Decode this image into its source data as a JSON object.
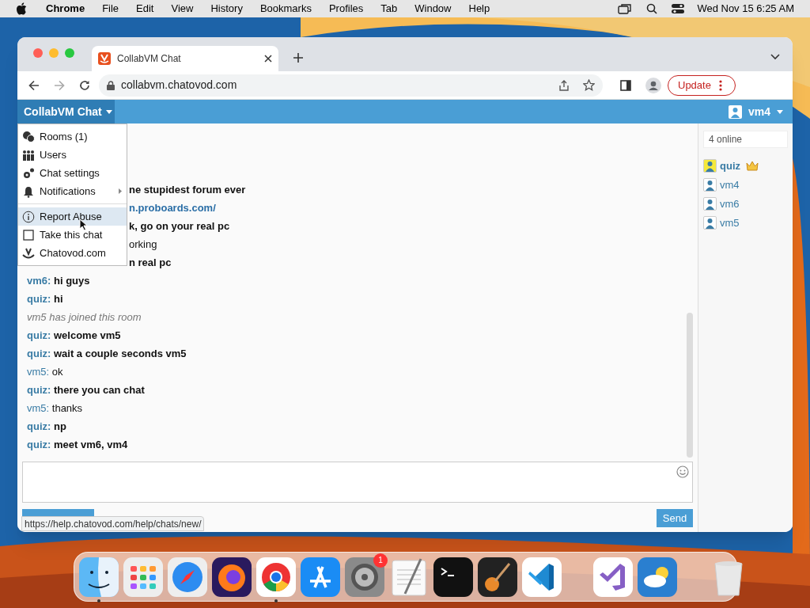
{
  "menubar": {
    "app": "Chrome",
    "menus": [
      "File",
      "Edit",
      "View",
      "History",
      "Bookmarks",
      "Profiles",
      "Tab",
      "Window",
      "Help"
    ],
    "clock": "Wed Nov 15 6:25 AM"
  },
  "browser": {
    "tab_title": "CollabVM Chat",
    "url": "collabvm.chatovod.com",
    "update_button": "Update"
  },
  "app": {
    "title": "CollabVM Chat",
    "account": "vm4",
    "menu": [
      {
        "kind": "rooms",
        "label": "Rooms (1)",
        "selected": false,
        "submenu": false
      },
      {
        "kind": "users",
        "label": "Users",
        "selected": false,
        "submenu": false
      },
      {
        "kind": "settings",
        "label": "Chat settings",
        "selected": false,
        "submenu": false
      },
      {
        "kind": "bell",
        "label": "Notifications",
        "selected": false,
        "submenu": true
      },
      {
        "kind": "separator"
      },
      {
        "kind": "info",
        "label": "Report Abuse",
        "selected": true,
        "submenu": false
      },
      {
        "kind": "frame",
        "label": "Take this chat",
        "selected": false,
        "submenu": false
      },
      {
        "kind": "logo",
        "label": "Chatovod.com",
        "selected": false,
        "submenu": false
      }
    ],
    "messages": [
      {
        "kind": "fragment",
        "text": "ne stupidest forum ever",
        "bold": true
      },
      {
        "kind": "link_fragment",
        "text": "n.proboards.com/"
      },
      {
        "kind": "fragment",
        "text": "k, go on your real pc",
        "bold": true
      },
      {
        "kind": "fragment",
        "text": "orking",
        "bold": false
      },
      {
        "kind": "fragment",
        "text": "n real pc",
        "bold": true
      },
      {
        "kind": "message",
        "author": "vm6:",
        "text": "hi guys",
        "bold": true
      },
      {
        "kind": "message",
        "author": "quiz:",
        "text": "hi",
        "bold": true
      },
      {
        "kind": "system",
        "text": "vm5 has joined this room"
      },
      {
        "kind": "message",
        "author": "quiz:",
        "text": "welcome vm5",
        "bold": true
      },
      {
        "kind": "message",
        "author": "quiz:",
        "text": "wait a couple seconds vm5",
        "bold": true
      },
      {
        "kind": "message",
        "author": "vm5:",
        "text": "ok",
        "bold": false
      },
      {
        "kind": "message",
        "author": "quiz:",
        "text": "there you can chat",
        "bold": true
      },
      {
        "kind": "message",
        "author": "vm5:",
        "text": "thanks",
        "bold": false
      },
      {
        "kind": "message",
        "author": "quiz:",
        "text": "np",
        "bold": true
      },
      {
        "kind": "message",
        "author": "quiz:",
        "text": "meet vm6, vm4",
        "bold": true
      }
    ],
    "send_button": "Send",
    "online": {
      "placeholder": "4 online"
    },
    "users": [
      {
        "name": "quiz",
        "owner": true
      },
      {
        "name": "vm4",
        "owner": false
      },
      {
        "name": "vm6",
        "owner": false
      },
      {
        "name": "vm5",
        "owner": false
      }
    ],
    "status_url": "https://help.chatovod.com/help/chats/new/"
  },
  "dock": [
    {
      "kind": "finder",
      "running": true
    },
    {
      "kind": "launchpad",
      "running": false
    },
    {
      "kind": "safari",
      "running": false
    },
    {
      "kind": "firefox",
      "running": false
    },
    {
      "kind": "chrome",
      "running": true
    },
    {
      "kind": "appstore",
      "running": false
    },
    {
      "kind": "settings",
      "running": false,
      "badge": "1"
    },
    {
      "kind": "textedit",
      "running": false
    },
    {
      "kind": "terminal",
      "running": false
    },
    {
      "kind": "garageband",
      "running": false
    },
    {
      "kind": "vscode",
      "running": false
    },
    {
      "kind": "separator"
    },
    {
      "kind": "visualstudio",
      "running": false
    },
    {
      "kind": "weather",
      "running": false
    },
    {
      "kind": "separator"
    },
    {
      "kind": "trash",
      "running": false
    }
  ]
}
